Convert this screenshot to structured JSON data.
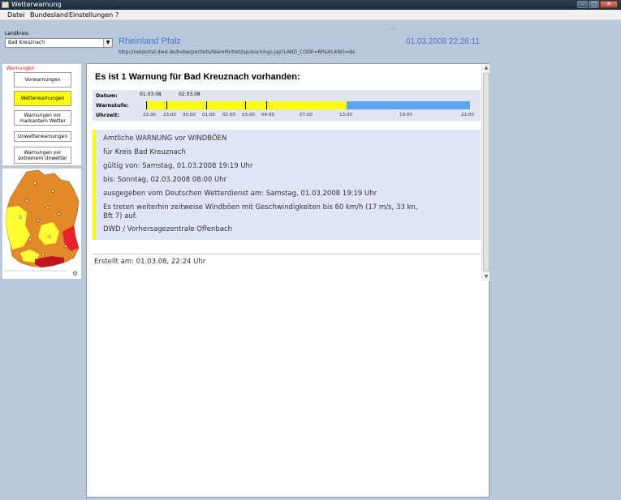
{
  "window": {
    "title": "Wetterwarnung",
    "buttons": {
      "minimize": "–",
      "maximize": "□",
      "close": "✕"
    }
  },
  "menu": [
    "Datei",
    "Bundesland",
    "Einstellungen",
    "?"
  ],
  "kreis": {
    "label": "Landkreis",
    "selected": "Bad Kreuznach"
  },
  "header": {
    "bundesland": "Rheinland Pfalz",
    "datetime": "01.03.2008 22:26:11",
    "url": "http://netportal.dwd.de/bvbw/portlets/WarnPortlet/jsp/warnings.jsp?LAND_CODE=RP&KLANG=de"
  },
  "nav": {
    "header": "Warnungen",
    "items": [
      {
        "label": "Vorwarnungen",
        "active": false
      },
      {
        "label": "Wetterwarnungen",
        "active": true
      },
      {
        "label": "Warnungen vor markantem Wetter",
        "active": false
      },
      {
        "label": "Unwetterwarnungen",
        "active": false
      },
      {
        "label": "Warnungen vor extremem Unwetter",
        "active": false
      }
    ]
  },
  "content": {
    "heading": "Es ist 1 Warnung für Bad Kreuznach vorhanden:",
    "timeline": {
      "label_date": "Datum:",
      "label_level": "Warnstufe:",
      "label_time": "Uhrzeit:",
      "dates": [
        "01.03.08",
        "02.03.08"
      ],
      "times": [
        "22:30",
        "23:00",
        "00:00",
        "01:00",
        "02:00",
        "03:00",
        "04:00",
        "07:00",
        "13:00",
        "19:00",
        "22:00"
      ],
      "warning_fraction": 0.62,
      "colors": {
        "warning": "#ffff00",
        "none": "#5aa6ee"
      }
    },
    "warning": [
      "Amtliche WARNUNG vor WINDBÖEN",
      "für Kreis Bad Kreuznach",
      "gültig von: Samstag, 01.03.2008 19:19 Uhr",
      "bis: Sonntag, 02.03.2008 08:00 Uhr",
      "ausgegeben vom Deutschen Wetterdienst am: Samstag, 01.03.2008 19:19 Uhr",
      "Es treten weiterhin zeitweise Windböen mit Geschwindigkeiten bis 60 km/h (17 m/s, 33 kn,",
      "Bft 7) auf.",
      "DWD / Vorhersagezentrale Offenbach"
    ],
    "created": "Erstellt am: 01.03.08, 22:24 Uhr"
  },
  "icons": {
    "app": "weather-app-icon",
    "map": "germany-warning-map"
  }
}
